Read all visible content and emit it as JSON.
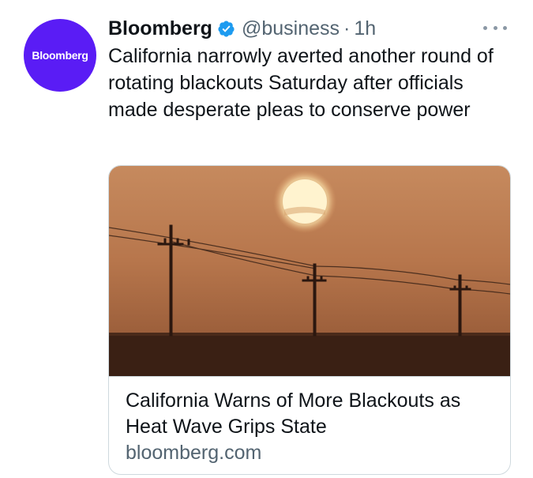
{
  "tweet": {
    "avatar_text": "Bloomberg",
    "display_name": "Bloomberg",
    "handle": "@business",
    "separator": "·",
    "time": "1h",
    "text": "California narrowly averted another round of rotating blackouts Saturday after officials made desperate pleas to conserve power",
    "more_icon": "more-horizontal-icon",
    "verified_icon": "verified-badge-icon"
  },
  "card": {
    "title": "California Warns of More Blackouts as Heat Wave Grips State",
    "domain": "bloomberg.com",
    "image_description_icon": "sunset-power-lines-image"
  },
  "colors": {
    "avatar_bg": "#5a1cf5",
    "verified": "#1d9bf0",
    "secondary_text": "#536471"
  }
}
